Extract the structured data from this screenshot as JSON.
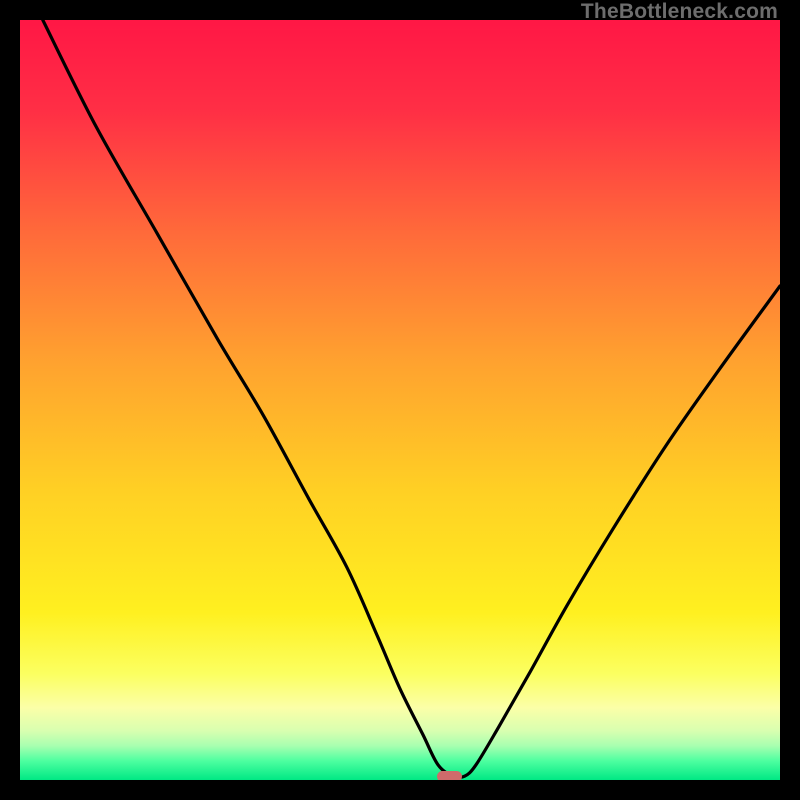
{
  "watermark": "TheBottleneck.com",
  "colors": {
    "frame": "#000000",
    "pill": "#cf6b6b",
    "curve": "#000000",
    "gradient_stops": [
      {
        "pos": 0.0,
        "color": "#ff1745"
      },
      {
        "pos": 0.12,
        "color": "#ff2f45"
      },
      {
        "pos": 0.28,
        "color": "#ff6a3a"
      },
      {
        "pos": 0.45,
        "color": "#ffa22f"
      },
      {
        "pos": 0.62,
        "color": "#ffd024"
      },
      {
        "pos": 0.78,
        "color": "#fff020"
      },
      {
        "pos": 0.86,
        "color": "#fbff60"
      },
      {
        "pos": 0.905,
        "color": "#fbffa8"
      },
      {
        "pos": 0.935,
        "color": "#d9ffb0"
      },
      {
        "pos": 0.955,
        "color": "#a8ffb0"
      },
      {
        "pos": 0.975,
        "color": "#4dffa0"
      },
      {
        "pos": 1.0,
        "color": "#00e884"
      }
    ]
  },
  "chart_data": {
    "type": "line",
    "title": "",
    "xlabel": "",
    "ylabel": "",
    "xlim": [
      0,
      100
    ],
    "ylim": [
      0,
      100
    ],
    "note": "V-shaped bottleneck curve; y≈0 at the optimal match (~x=55), rising steeply on both sides. Values are read off the plotted curve relative to the frame.",
    "series": [
      {
        "name": "bottleneck-curve",
        "x": [
          3,
          10,
          18,
          26,
          32,
          38,
          43,
          47,
          50,
          53,
          55,
          57,
          58.5,
          60,
          63,
          67,
          72,
          78,
          85,
          92,
          100
        ],
        "y": [
          100,
          86,
          72,
          58,
          48,
          37,
          28,
          19,
          12,
          6,
          2,
          0.5,
          0.5,
          2,
          7,
          14,
          23,
          33,
          44,
          54,
          65
        ]
      }
    ],
    "marker": {
      "x": 56.5,
      "y": 0.5,
      "width_pct": 3.2,
      "height_pct": 1.4
    }
  }
}
